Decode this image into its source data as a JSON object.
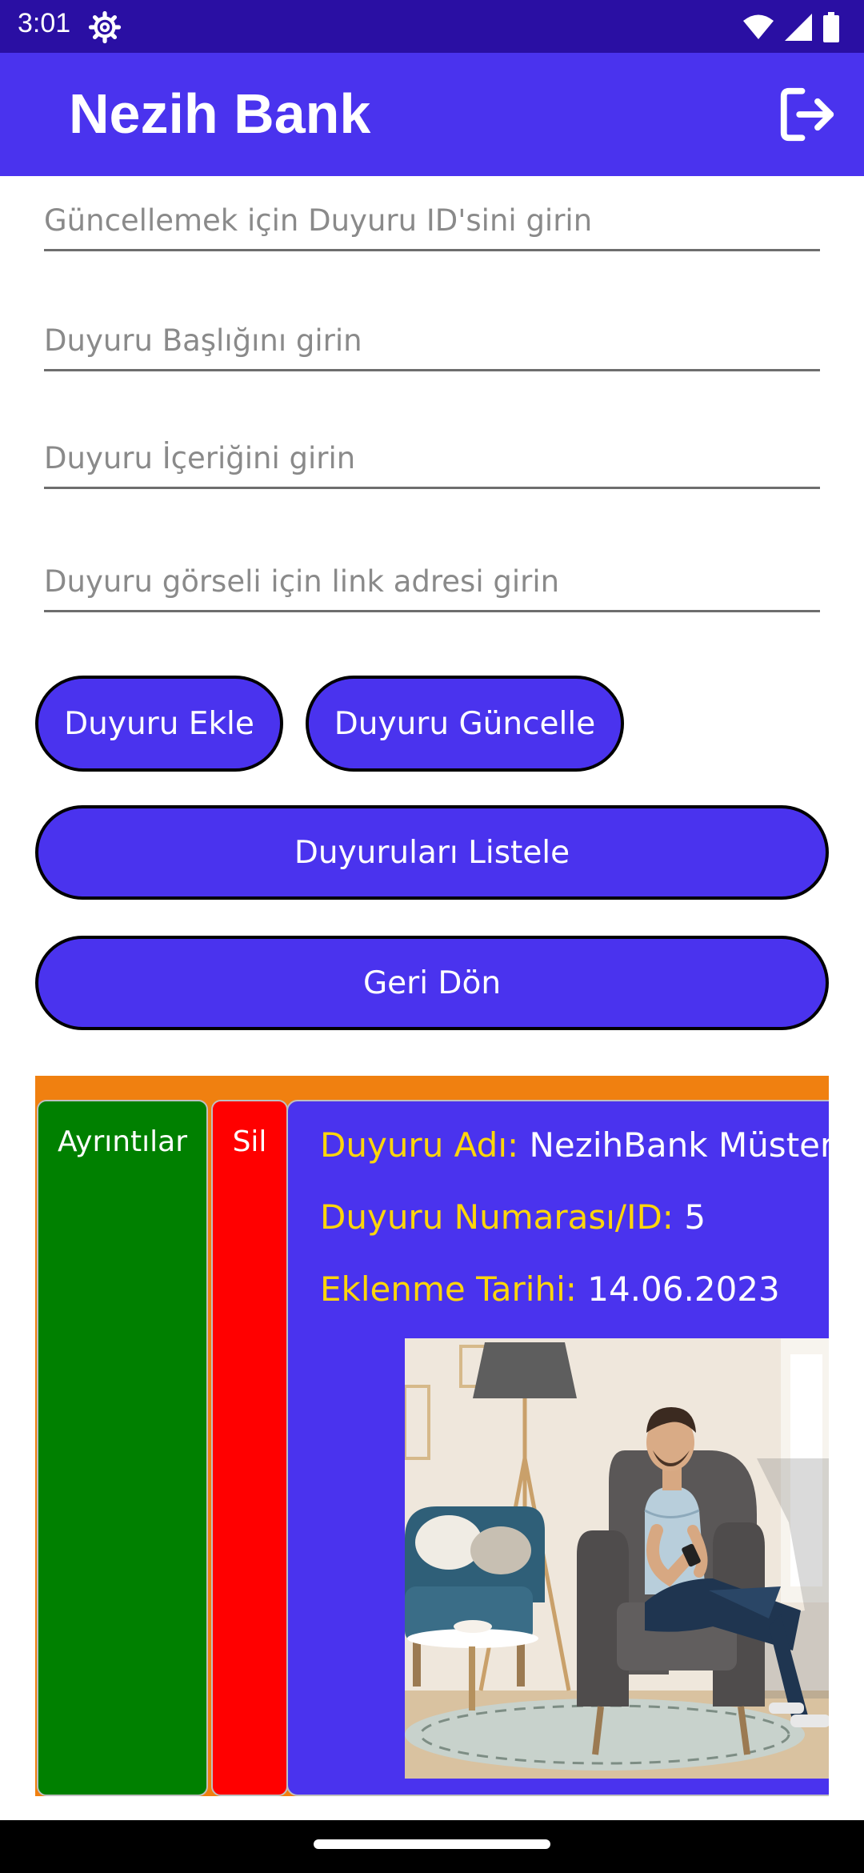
{
  "status_bar": {
    "time": "3:01",
    "icons": [
      "settings-gear-icon",
      "wifi-icon",
      "cellular-signal-icon",
      "battery-icon"
    ]
  },
  "app_bar": {
    "title": "Nezih Bank",
    "logout_icon": "logout-icon",
    "background": "#4a33ee"
  },
  "form": {
    "update_id_placeholder": "Güncellemek için Duyuru ID'sini girin",
    "title_placeholder": "Duyuru Başlığını girin",
    "content_placeholder": "Duyuru İçeriğini girin",
    "image_link_placeholder": "Duyuru görseli için link adresi girin"
  },
  "buttons": {
    "add": "Duyuru Ekle",
    "update": "Duyuru Güncelle",
    "list": "Duyuruları Listele",
    "back": "Geri Dön"
  },
  "announcement_card": {
    "details_label": "Ayrıntılar",
    "delete_label": "Sil",
    "name_label": "Duyuru Adı:",
    "name_value": "NezihBank Müsteris",
    "id_label": "Duyuru Numarası/ID:",
    "id_value": "5",
    "date_label": "Eklenme Tarihi:",
    "date_value": "14.06.2023",
    "image": "man-with-phone-in-armchair-photo"
  },
  "colors": {
    "primary": "#4a33ee",
    "status_bar": "#2a0fa3",
    "card_frame": "#f08010",
    "details_green": "#008000",
    "delete_red": "#ff0000",
    "label_yellow": "#ffd60a"
  }
}
